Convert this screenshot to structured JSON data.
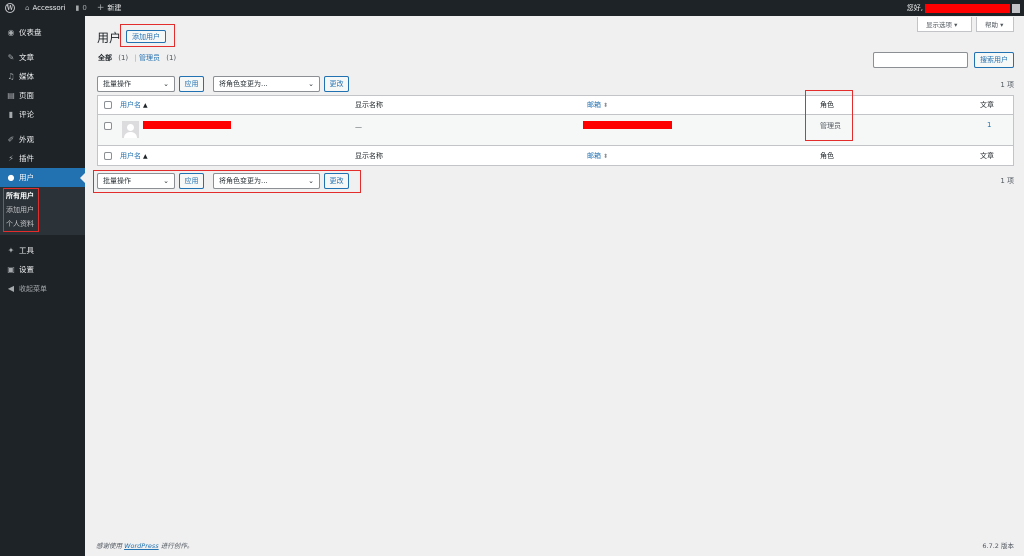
{
  "adminbar": {
    "site_name": "Accessori",
    "comments_count": "0",
    "new_label": "新建",
    "greeting": "您好,"
  },
  "sidebar": {
    "items": [
      {
        "label": "仪表盘",
        "icon": "dashboard-icon"
      },
      {
        "label": "文章",
        "icon": "pin-icon"
      },
      {
        "label": "媒体",
        "icon": "media-icon"
      },
      {
        "label": "页面",
        "icon": "page-icon"
      },
      {
        "label": "评论",
        "icon": "comment-icon"
      },
      {
        "label": "外观",
        "icon": "brush-icon"
      },
      {
        "label": "插件",
        "icon": "plugin-icon"
      },
      {
        "label": "用户",
        "icon": "user-icon"
      },
      {
        "label": "工具",
        "icon": "wrench-icon"
      },
      {
        "label": "设置",
        "icon": "settings-icon"
      },
      {
        "label": "收起菜单",
        "icon": "collapse-icon"
      }
    ],
    "submenu": [
      "所有用户",
      "添加用户",
      "个人资料"
    ]
  },
  "header": {
    "screen_options": "显示选项 ▾",
    "help": "帮助 ▾",
    "title": "用户",
    "add_user": "添加用户",
    "search_button": "搜索用户"
  },
  "filters": {
    "all_label": "全部",
    "all_count": "(1)",
    "separator": "|",
    "admin_label": "管理员",
    "admin_count": "(1)"
  },
  "bulk": {
    "bulk_action": "批量操作",
    "apply": "应用",
    "change_role": "将角色变更为...",
    "change": "更改",
    "count_text": "1 项"
  },
  "table": {
    "columns": {
      "username": "用户名",
      "display_name": "显示名称",
      "email": "邮箱",
      "role": "角色",
      "posts": "文章"
    },
    "rows": [
      {
        "display_name": "—",
        "role": "管理员",
        "posts": "1"
      }
    ]
  },
  "footer": {
    "thanks_prefix": "感谢使用",
    "wordpress": "WordPress",
    "thanks_suffix": "进行创作。",
    "version": "6.7.2 版本"
  },
  "colors": {
    "sidebar_bg": "#1d2327",
    "accent": "#2271b1",
    "highlight": "#e32c2c"
  }
}
